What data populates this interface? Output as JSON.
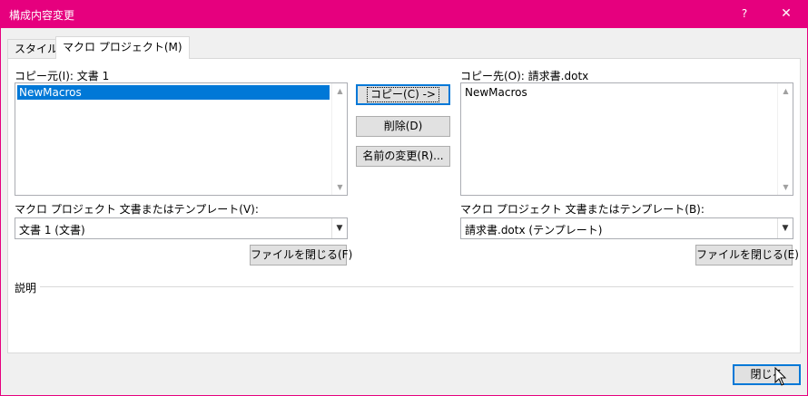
{
  "window": {
    "title": "構成内容変更",
    "help_glyph": "?",
    "close_glyph": "✕"
  },
  "tabs": [
    {
      "label": "スタイル"
    },
    {
      "label": "マクロ プロジェクト(M)"
    }
  ],
  "left": {
    "list_label": "コピー元(I): 文書 1",
    "items": [
      "NewMacros"
    ],
    "selected": "NewMacros",
    "combo_label": "マクロ プロジェクト 文書またはテンプレート(V):",
    "combo_value": "文書 1 (文書)",
    "close_file_button": "ファイルを閉じる(F)"
  },
  "right": {
    "list_label": "コピー先(O): 請求書.dotx",
    "items": [
      "NewMacros"
    ],
    "combo_label": "マクロ プロジェクト 文書またはテンプレート(B):",
    "combo_value": "請求書.dotx (テンプレート)",
    "close_file_button": "ファイルを閉じる(E)"
  },
  "actions": {
    "copy": "コピー(C) ->",
    "delete": "削除(D)",
    "rename": "名前の変更(R)..."
  },
  "description_label": "説明",
  "footer": {
    "close_button": "閉じる"
  },
  "colors": {
    "titlebar": "#e6007e",
    "selection": "#0078d7"
  }
}
